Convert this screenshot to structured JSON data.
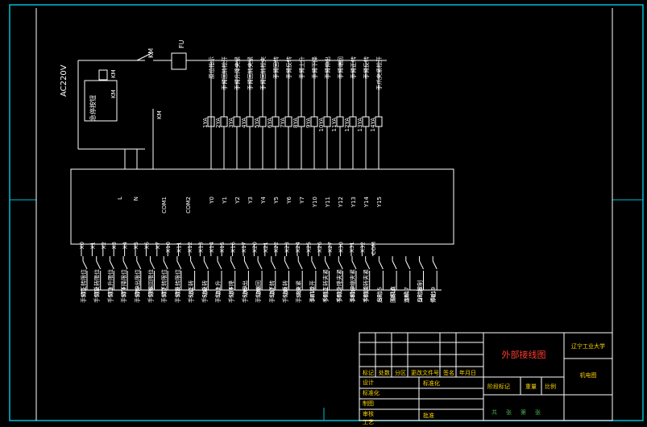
{
  "diagram": {
    "frame_color": "#00bcd4",
    "line_color": "#ffffff",
    "text_color": "#ffffff",
    "title_red": "#ff3b30",
    "title_yellow": "#ffd400",
    "title_green": "#4caf50",
    "power": {
      "supply": "AC220V",
      "stop_button": "急停按钮",
      "fuse": "FU",
      "km_label": "KM",
      "relay_labels": [
        "KM",
        "KM",
        "KM"
      ]
    },
    "plc": {
      "left_top_labels": [
        "L",
        "N",
        "COM1",
        "COM2"
      ],
      "outputs": [
        "Y0",
        "Y1",
        "Y2",
        "Y3",
        "Y4",
        "Y5",
        "Y6",
        "Y7",
        "Y10",
        "Y11",
        "Y12",
        "Y13",
        "Y14",
        "Y15"
      ],
      "inputs_left": [
        "X0",
        "X1",
        "X2",
        "X3",
        "X4",
        "X5",
        "X6",
        "X7",
        "X10",
        "X11",
        "X12"
      ],
      "inputs_right": [
        "X13",
        "X14",
        "X15",
        "X16",
        "X17",
        "X20",
        "X21",
        "X22",
        "X23",
        "X24",
        "X25",
        "X26",
        "X27",
        "X30",
        "X31",
        "X32",
        "COM"
      ]
    },
    "coils": [
      "1YA",
      "2YA",
      "3YA",
      "4YA",
      "5YA",
      "6YA",
      "7YA",
      "8YA",
      "9YA",
      "10YA",
      "11YA",
      "12YA",
      "13YA",
      "14YA"
    ],
    "output_desc": [
      "原位指示",
      "手臂回转松开",
      "手臂升降夹紧",
      "手臂回转夹紧",
      "手臂回转松夹",
      "手臂回转",
      "手臂反转",
      "手臂上升",
      "手臂下降",
      "手臂伸出",
      "手臂缩回",
      "手臂正转",
      "手臂反转",
      "手爪夹紧松开"
    ],
    "switches": [
      "ST1",
      "ST2",
      "ST3",
      "ST4",
      "ST5",
      "ST6",
      "ST7",
      "ST8",
      "SB1",
      "SB2",
      "SB3",
      "SB4",
      "SB5",
      "SB6",
      "SB7",
      "SB8",
      "SB9",
      "SB10",
      "SB11",
      "SB12",
      "SB13",
      "SB14",
      "SB15",
      "SB16",
      "SB17",
      "SB18",
      "SB19"
    ],
    "input_desc": [
      "手臂正转限位",
      "手臂反转限位",
      "手臂上升限位",
      "手臂下降限位",
      "手臂伸出限位",
      "手臂缩回限位",
      "手臂正转限位",
      "手臂反转限位",
      "手动正转",
      "手动反转",
      "手动上升",
      "手动下降",
      "手动伸出",
      "手动缩回",
      "手动正转",
      "手动反转",
      "手爪夹紧",
      "手爪松开",
      "手臂正转夹紧",
      "手臂升降夹紧",
      "手臂伸缩夹紧",
      "手臂回转夹紧",
      "启动",
      "回原点",
      "连续",
      "自动控制",
      "停止"
    ],
    "title_block": {
      "drawing_title": "外部接线图",
      "school": "辽宁工业大学",
      "drawing_no": "机电图",
      "rows": [
        "标记",
        "处数",
        "分区",
        "更改文件号",
        "签名",
        "年月日"
      ],
      "left_cells": [
        "设计",
        "标准化",
        "制图",
        "审核",
        "工艺",
        "批准"
      ],
      "right_cells": [
        "阶段标记",
        "重量",
        "比例"
      ],
      "bottom_cells": [
        "共",
        "张",
        "第",
        "张"
      ]
    }
  }
}
